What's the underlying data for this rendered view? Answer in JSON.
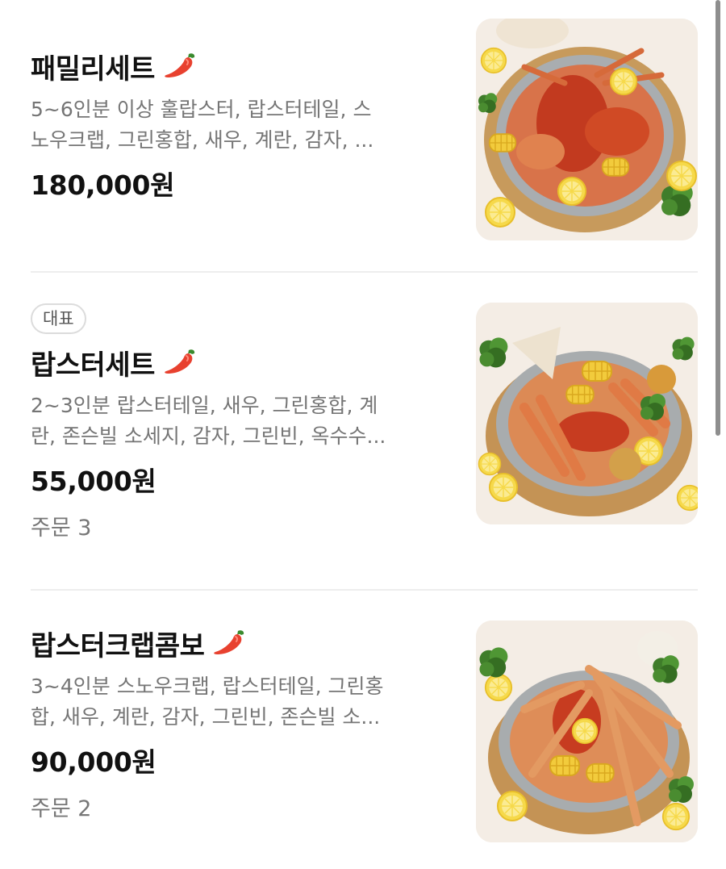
{
  "menu": {
    "items": [
      {
        "name": "패밀리세트",
        "desc_line1": "5~6인분 이상 훌랍스터, 랍스터테일, 스",
        "desc_line2": "노우크랩, 그린홍합, 새우, 계란, 감자, ...",
        "price": "180,000원",
        "icon": "chili-pepper-icon"
      },
      {
        "badge": "대표",
        "name": "랍스터세트",
        "desc_line1": "2~3인분 랍스터테일, 새우, 그린홍합, 계",
        "desc_line2": "란, 존슨빌 소세지, 감자, 그린빈, 옥수수...",
        "price": "55,000원",
        "orders": "주문 3",
        "icon": "chili-pepper-icon"
      },
      {
        "name": "랍스터크랩콤보",
        "desc_line1": "3~4인분 스노우크랩, 랍스터테일, 그린홍",
        "desc_line2": "합, 새우, 계란, 감자, 그린빈, 존슨빌 소...",
        "price": "90,000원",
        "orders": "주문 2",
        "icon": "chili-pepper-icon"
      }
    ]
  },
  "colors": {
    "pepper": "#e8412f",
    "divider": "#ededed",
    "text_secondary": "#757575"
  }
}
